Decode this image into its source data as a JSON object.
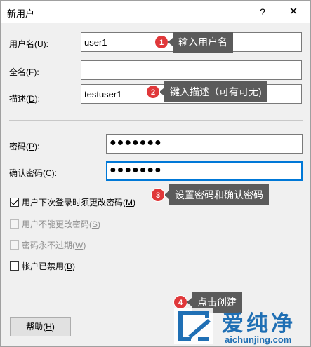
{
  "dialog": {
    "title": "新用户",
    "help_glyph": "?",
    "close_glyph": "✕"
  },
  "fields": {
    "username": {
      "label": "用户名(",
      "key": "U",
      "suffix": "):",
      "value": "user1"
    },
    "fullname": {
      "label": "全名(",
      "key": "F",
      "suffix": "):",
      "value": ""
    },
    "description": {
      "label": "描述(",
      "key": "D",
      "suffix": "):",
      "value": "testuser1"
    },
    "password": {
      "label": "密码(",
      "key": "P",
      "suffix": "):",
      "value": "●●●●●●●"
    },
    "confirm": {
      "label": "确认密码(",
      "key": "C",
      "suffix": "):",
      "value": "●●●●●●●"
    }
  },
  "checkboxes": [
    {
      "label": "用户下次登录时须更改密码(",
      "key": "M",
      "suffix": ")",
      "checked": true,
      "enabled": true
    },
    {
      "label": "用户不能更改密码(",
      "key": "S",
      "suffix": ")",
      "checked": false,
      "enabled": false
    },
    {
      "label": "密码永不过期(",
      "key": "W",
      "suffix": ")",
      "checked": false,
      "enabled": false
    },
    {
      "label": "帐户已禁用(",
      "key": "B",
      "suffix": ")",
      "checked": false,
      "enabled": true
    }
  ],
  "buttons": {
    "help": {
      "label": "帮助(",
      "key": "H",
      "suffix": ")"
    }
  },
  "annotations": [
    {
      "number": "1",
      "text": "输入用户名"
    },
    {
      "number": "2",
      "text": "键入描述（可有可无)"
    },
    {
      "number": "3",
      "text": "设置密码和确认密码"
    },
    {
      "number": "4",
      "text": "点击创建"
    }
  ],
  "watermark": {
    "text": "爱纯净",
    "url": "aichunjing.com",
    "color": "#1f6fb4"
  },
  "colors": {
    "badge": "#e0383a",
    "tooltip": "#5b5b5b",
    "focus": "#0078d7"
  }
}
